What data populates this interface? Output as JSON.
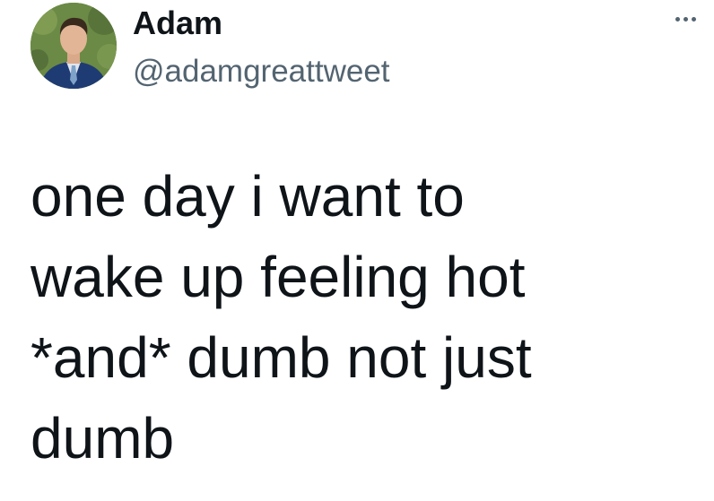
{
  "author": {
    "display_name": "Adam",
    "handle": "@adamgreattweet",
    "avatar_icon": "profile-photo-man-in-suit"
  },
  "actions": {
    "more_icon": "more-options-icon"
  },
  "tweet": {
    "lines": [
      "one day i want to",
      "wake up feeling hot",
      "*and* dumb not just",
      "dumb"
    ]
  },
  "colors": {
    "text_primary": "#0f1419",
    "text_secondary": "#536471",
    "background": "#ffffff"
  }
}
